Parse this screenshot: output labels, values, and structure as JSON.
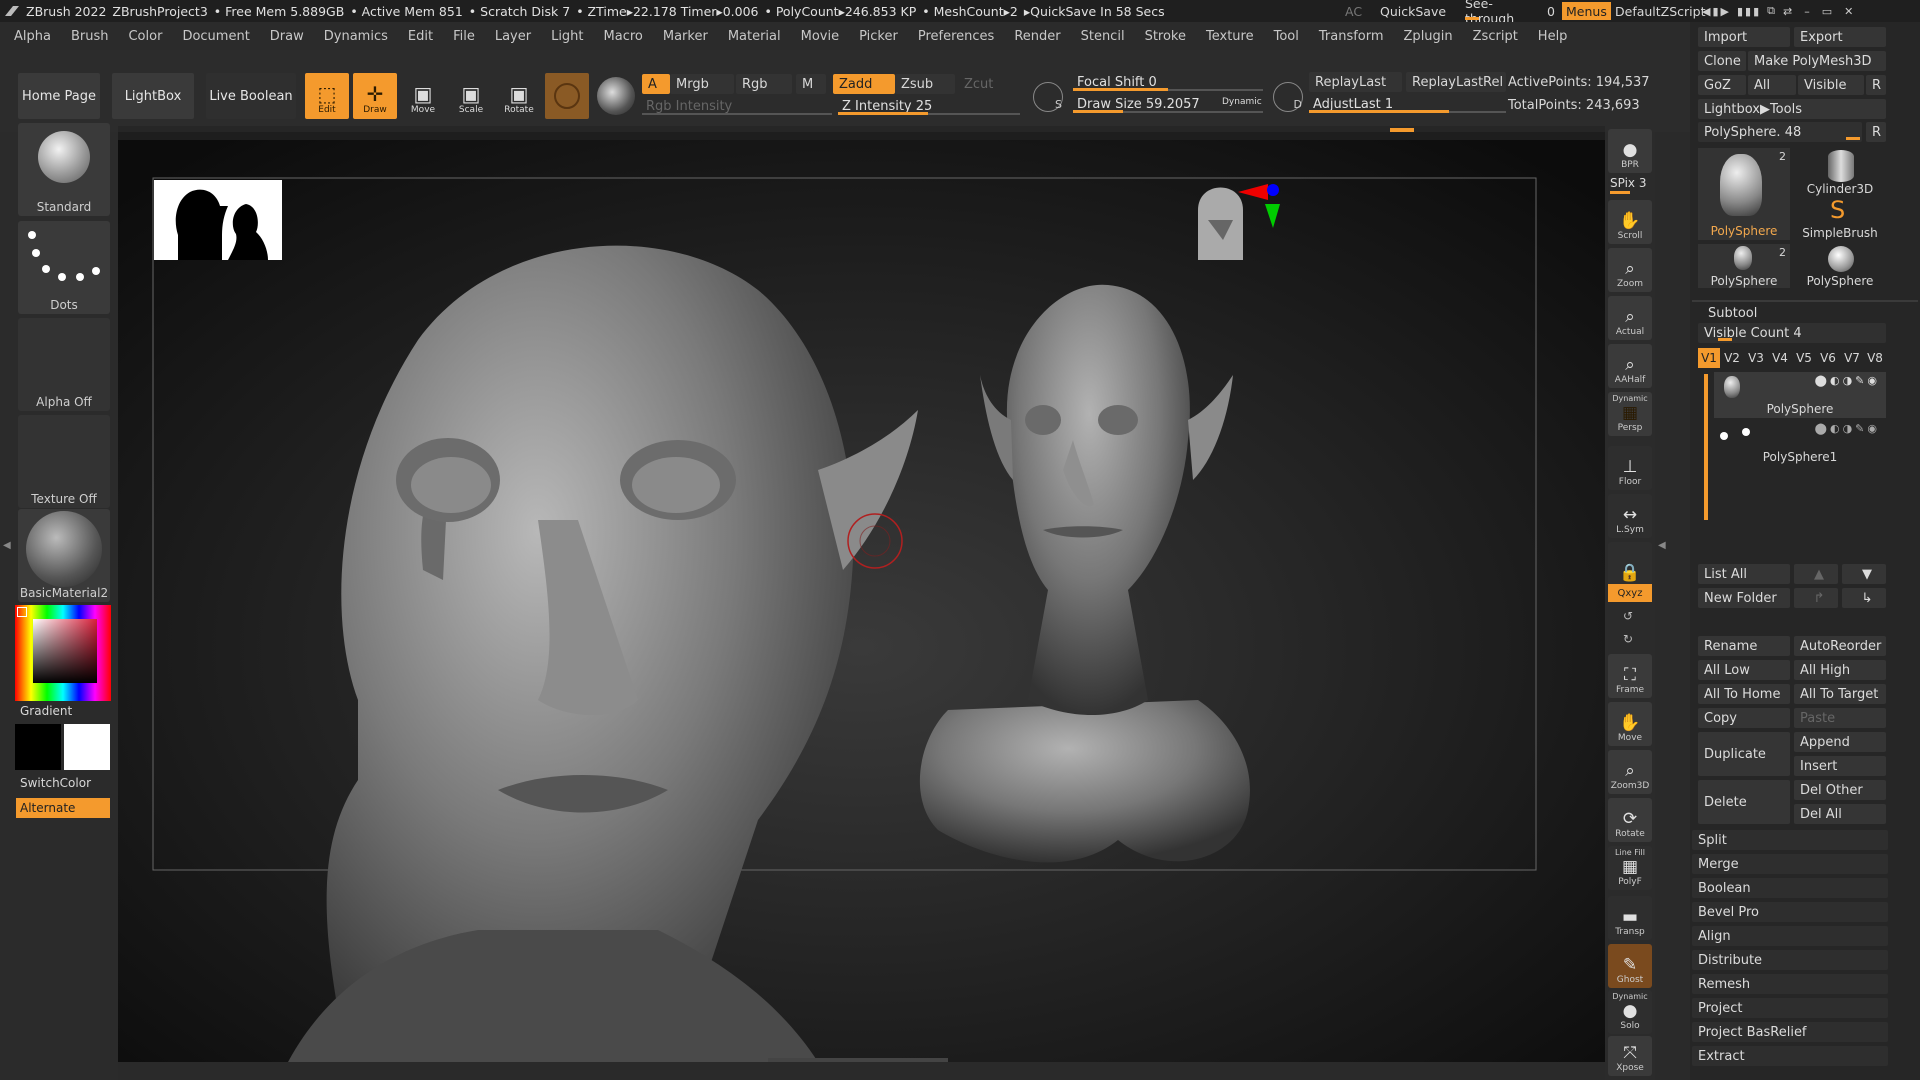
{
  "titlebar": {
    "app": "ZBrush 2022",
    "project": "ZBrushProject3",
    "free_mem": "• Free Mem 5.889GB",
    "active_mem": "• Active Mem 851",
    "scratch": "• Scratch Disk 7",
    "ztime": "• ZTime▸22.178 Timer▸0.006",
    "polycount": "• PolyCount▸246.853 KP",
    "meshcount": "• MeshCount▸2",
    "quicksave_timer": "▸QuickSave In 58 Secs",
    "ac": "AC",
    "quicksave": "QuickSave",
    "see_through": "See-through",
    "see_through_value": "0",
    "menus": "Menus",
    "script": "DefaultZScript"
  },
  "menubar": [
    "Alpha",
    "Brush",
    "Color",
    "Document",
    "Draw",
    "Dynamics",
    "Edit",
    "File",
    "Layer",
    "Light",
    "Macro",
    "Marker",
    "Material",
    "Movie",
    "Picker",
    "Preferences",
    "Render",
    "Stencil",
    "Stroke",
    "Texture",
    "Tool",
    "Transform",
    "Zplugin",
    "Zscript",
    "Help"
  ],
  "toolbar": {
    "home": "Home Page",
    "lightbox": "LightBox",
    "live_boolean": "Live Boolean",
    "edit": "Edit",
    "draw": "Draw",
    "move": "Move",
    "scale": "Scale",
    "rotate": "Rotate",
    "a": "A",
    "mrgb": "Mrgb",
    "rgb": "Rgb",
    "m": "M",
    "zadd": "Zadd",
    "zsub": "Zsub",
    "zcut": "Zcut",
    "rgb_intensity": "Rgb Intensity",
    "z_intensity": "Z Intensity 25",
    "focal_shift": "Focal Shift 0",
    "draw_size": "Draw Size 59.2057",
    "dynamic": "Dynamic",
    "replay_last": "ReplayLast",
    "replay_last_rel": "ReplayLastRel",
    "adjust_last": "AdjustLast 1",
    "active_points": "ActivePoints: 194,537",
    "total_points": "TotalPoints: 243,693"
  },
  "leftbar": {
    "brush": "Standard",
    "stroke": "Dots",
    "alpha": "Alpha Off",
    "texture": "Texture Off",
    "material": "BasicMaterial2",
    "gradient": "Gradient",
    "switch_color": "SwitchColor",
    "alternate": "Alternate"
  },
  "rightnav": [
    "BPR",
    "SPix 3",
    "Scroll",
    "Zoom",
    "Actual",
    "AAHalf",
    "Persp",
    "Floor",
    "L.Sym",
    "",
    "Frame",
    "Move",
    "Zoom3D",
    "Rotate",
    "PolyF",
    "Transp",
    "Ghost",
    "Solo",
    "Xpose"
  ],
  "rightnav_extra": {
    "dynamic": "Dynamic",
    "linefill": "Line Fill",
    "xyz": "Qxyz",
    "dynamic2": "Dynamic"
  },
  "panel": {
    "import": "Import",
    "export": "Export",
    "clone": "Clone",
    "make_polymesh": "Make PolyMesh3D",
    "goz": "GoZ",
    "all": "All",
    "visible": "Visible",
    "r": "R",
    "lightbox_tools": "Lightbox▶Tools",
    "polysphere_slider": "PolySphere. 48",
    "tool_count": "2",
    "tools": [
      "PolySphere",
      "Cylinder3D",
      "SimpleBrush",
      "PolySphere",
      "PolySphere"
    ],
    "tool_count2": "2",
    "subtool": "Subtool",
    "visible_count": "Visible Count 4",
    "versions": [
      "V1",
      "V2",
      "V3",
      "V4",
      "V5",
      "V6",
      "V7",
      "V8"
    ],
    "subtools": [
      "PolySphere",
      "PolySphere1"
    ],
    "list_all": "List All",
    "new_folder": "New Folder",
    "rename": "Rename",
    "auto_reorder": "AutoReorder",
    "all_low": "All Low",
    "all_high": "All High",
    "all_to_home": "All To Home",
    "all_to_target": "All To Target",
    "copy": "Copy",
    "paste": "Paste",
    "duplicate": "Duplicate",
    "append": "Append",
    "insert": "Insert",
    "delete": "Delete",
    "del_other": "Del Other",
    "del_all": "Del All",
    "list": [
      "Split",
      "Merge",
      "Boolean",
      "Bevel Pro",
      "Align",
      "Distribute",
      "Remesh",
      "Project",
      "Project BasRelief",
      "Extract"
    ]
  },
  "colors": {
    "accent": "#f49a2d",
    "bg": "#2b2b2b",
    "canvas": "#1e1e1e"
  }
}
